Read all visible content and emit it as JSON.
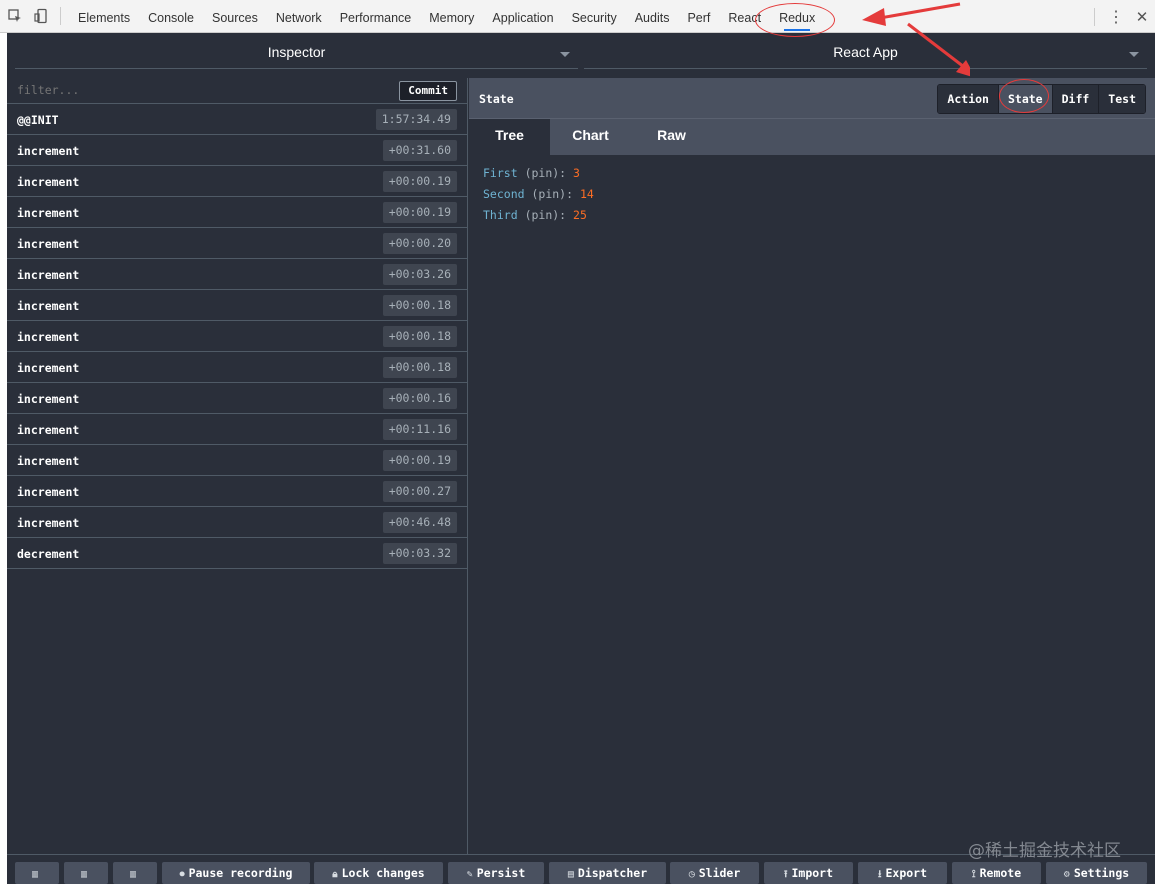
{
  "devtools": {
    "tabs": [
      "Elements",
      "Console",
      "Sources",
      "Network",
      "Performance",
      "Memory",
      "Application",
      "Security",
      "Audits",
      "Perf",
      "React",
      "Redux"
    ],
    "active_tab": "Redux",
    "kebab": "⋮",
    "close": "✕"
  },
  "selects": {
    "left": "Inspector",
    "right": "React App"
  },
  "filter": {
    "placeholder": "filter...",
    "commit_label": "Commit"
  },
  "actions": [
    {
      "name": "@@INIT",
      "time": "1:57:34.49"
    },
    {
      "name": "increment",
      "time": "+00:31.60"
    },
    {
      "name": "increment",
      "time": "+00:00.19"
    },
    {
      "name": "increment",
      "time": "+00:00.19"
    },
    {
      "name": "increment",
      "time": "+00:00.20"
    },
    {
      "name": "increment",
      "time": "+00:03.26"
    },
    {
      "name": "increment",
      "time": "+00:00.18"
    },
    {
      "name": "increment",
      "time": "+00:00.18"
    },
    {
      "name": "increment",
      "time": "+00:00.18"
    },
    {
      "name": "increment",
      "time": "+00:00.16"
    },
    {
      "name": "increment",
      "time": "+00:11.16"
    },
    {
      "name": "increment",
      "time": "+00:00.19"
    },
    {
      "name": "increment",
      "time": "+00:00.27"
    },
    {
      "name": "increment",
      "time": "+00:46.48"
    },
    {
      "name": "decrement",
      "time": "+00:03.32"
    }
  ],
  "inspector": {
    "header_title": "State",
    "modes": [
      "Action",
      "State",
      "Diff",
      "Test"
    ],
    "active_mode": "State",
    "views": [
      "Tree",
      "Chart",
      "Raw"
    ],
    "active_view": "Tree",
    "tree": [
      {
        "key": "First",
        "pin": "(pin):",
        "value": "3"
      },
      {
        "key": "Second",
        "pin": "(pin):",
        "value": "14"
      },
      {
        "key": "Third",
        "pin": "(pin):",
        "value": "25"
      }
    ]
  },
  "bottom_bar": {
    "buttons": [
      {
        "label": "",
        "icon": "layout-icon"
      },
      {
        "label": "",
        "icon": "layout-icon"
      },
      {
        "label": "",
        "icon": "layout-icon"
      },
      {
        "label": "Pause recording",
        "icon": "pause-icon"
      },
      {
        "label": "Lock changes",
        "icon": "lock-icon"
      },
      {
        "label": "Persist",
        "icon": "pin-icon"
      },
      {
        "label": "Dispatcher",
        "icon": "keyboard-icon"
      },
      {
        "label": "Slider",
        "icon": "clock-icon"
      },
      {
        "label": "Import",
        "icon": "upload-icon"
      },
      {
        "label": "Export",
        "icon": "download-icon"
      },
      {
        "label": "Remote",
        "icon": "antenna-icon"
      },
      {
        "label": "Settings",
        "icon": "gear-icon"
      }
    ]
  },
  "watermark": "@稀土掘金技术社区",
  "colors": {
    "panel_bg": "#2a2f3a",
    "header_bg": "#4a5160",
    "tree_key": "#6fb3d2",
    "tree_value": "#fc6d24",
    "annotation": "#e43b3b"
  }
}
